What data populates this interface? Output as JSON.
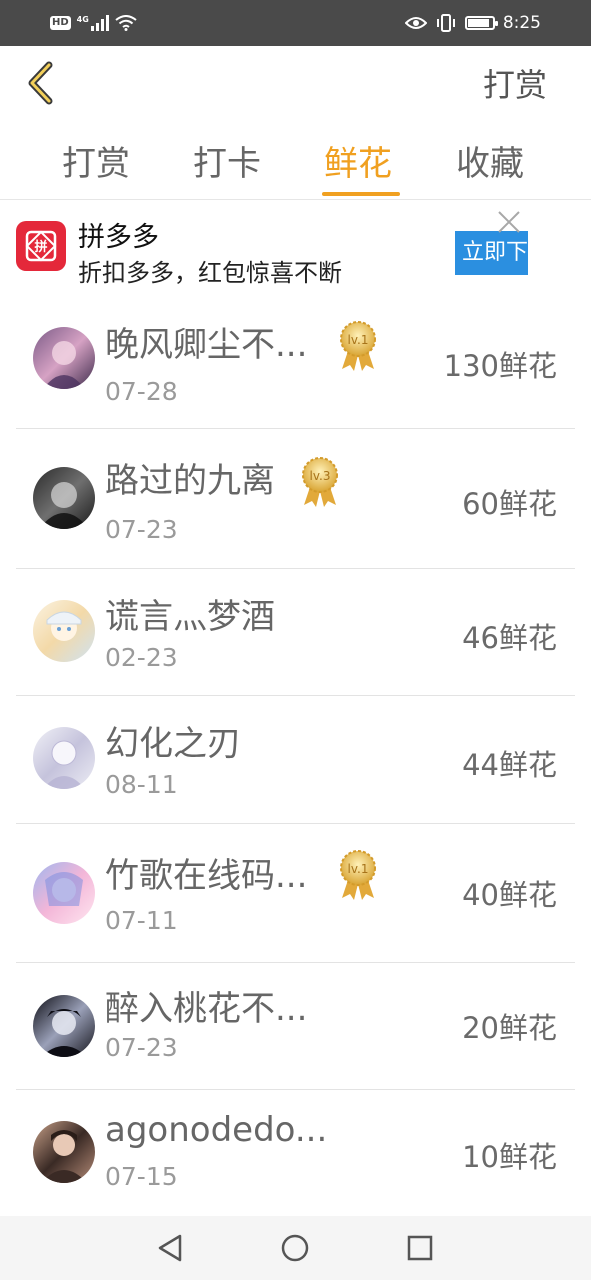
{
  "status_bar": {
    "hd_label": "HD",
    "network_type": "4G",
    "time": "8:25",
    "icons": [
      "signal-icon",
      "wifi-icon",
      "eye-icon",
      "vibrate-icon",
      "battery-icon"
    ]
  },
  "header": {
    "back_icon": "chevron-left-icon",
    "action_label": "打赏"
  },
  "tabs": [
    {
      "label": "打赏",
      "active": false
    },
    {
      "label": "打卡",
      "active": false
    },
    {
      "label": "鲜花",
      "active": true
    },
    {
      "label": "收藏",
      "active": false
    }
  ],
  "ad": {
    "logo_text": "拼",
    "title": "拼多多",
    "description": "折扣多多，红包惊喜不断",
    "cta_label": "立即下",
    "close_icon": "close-icon"
  },
  "list": [
    {
      "name": "晚风卿尘不...",
      "date": "07-28",
      "amount": "130鲜花",
      "badge": "lv.1"
    },
    {
      "name": "路过的九离",
      "date": "07-23",
      "amount": "60鲜花",
      "badge": "lv.3"
    },
    {
      "name": "谎言灬梦酒",
      "date": "02-23",
      "amount": "46鲜花",
      "badge": ""
    },
    {
      "name": "幻化之刃",
      "date": "08-11",
      "amount": "44鲜花",
      "badge": ""
    },
    {
      "name": "竹歌在线码...",
      "date": "07-11",
      "amount": "40鲜花",
      "badge": "lv.1"
    },
    {
      "name": "醉入桃花不...",
      "date": "07-23",
      "amount": "20鲜花",
      "badge": ""
    },
    {
      "name": "agonodedo...",
      "date": "07-15",
      "amount": "10鲜花",
      "badge": ""
    }
  ],
  "colors": {
    "accent": "#f0a020",
    "status_bar_bg": "#4a4a4a",
    "ad_logo_bg": "#e4283a",
    "ad_cta_bg": "#2b8fe0"
  },
  "nav_bar": {
    "icons": [
      "nav-back-icon",
      "nav-home-icon",
      "nav-recents-icon"
    ]
  }
}
